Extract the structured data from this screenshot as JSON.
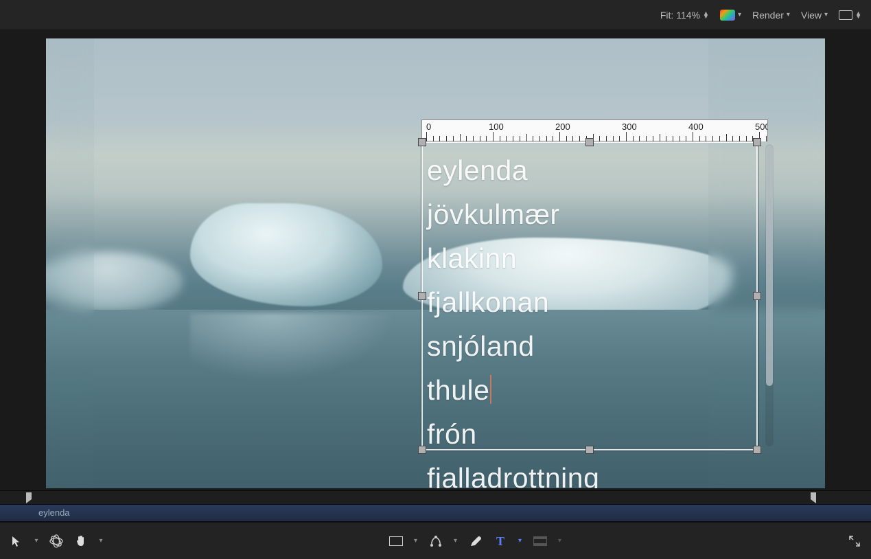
{
  "toolbar": {
    "fit_label": "Fit:",
    "fit_value": "114%",
    "render_label": "Render",
    "view_label": "View"
  },
  "ruler": {
    "labels": [
      "0",
      "100",
      "200",
      "300",
      "400",
      "500"
    ]
  },
  "text_box": {
    "lines": [
      "eylenda",
      "jövkulmær",
      "klakinn",
      "fjallkonan",
      "snjóland",
      "thule",
      "frón",
      "fjalladrottning"
    ],
    "cursor_after_line_index": 5
  },
  "clip": {
    "name": "eylenda"
  },
  "tools": {
    "arrow": "select-transform-tool",
    "orbit": "3d-transform-tool",
    "hand": "pan-tool",
    "rect": "rectangle-mask-tool",
    "pen": "bezier-tool",
    "brush": "paint-stroke-tool",
    "text": "text-tool",
    "letterbox": "shape-mask-tool",
    "expand": "fullscreen-toggle"
  }
}
